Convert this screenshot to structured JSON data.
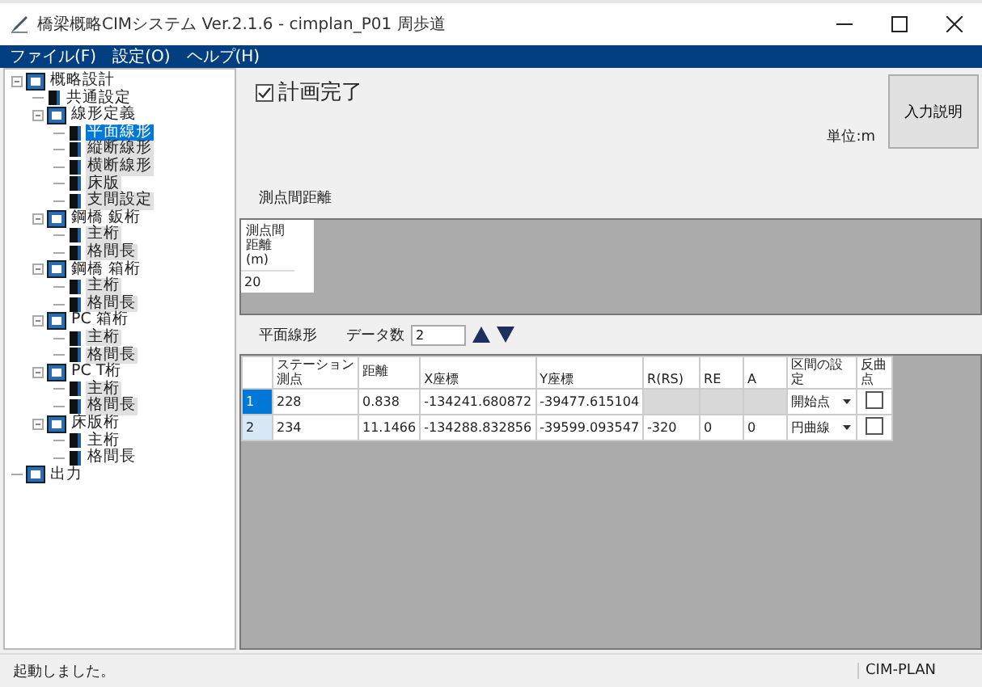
{
  "window": {
    "title": "橋梁概略CIMシステム Ver.2.1.6 - cimplan_P01 周歩道"
  },
  "menu": [
    "ファイル(F)",
    "設定(O)",
    "ヘルプ(H)"
  ],
  "tree": [
    {
      "label": "概略設計",
      "kind": "folder",
      "shaded": false,
      "selected": false,
      "children": [
        {
          "label": "共通設定",
          "kind": "leaf",
          "shaded": false,
          "selected": false
        },
        {
          "label": "線形定義",
          "kind": "folder",
          "shaded": false,
          "selected": false,
          "children": [
            {
              "label": "平面線形",
              "kind": "leaf",
              "shaded": false,
              "selected": true
            },
            {
              "label": "縦断線形",
              "kind": "leaf",
              "shaded": true,
              "selected": false
            },
            {
              "label": "横断線形",
              "kind": "leaf",
              "shaded": true,
              "selected": false
            },
            {
              "label": "床版",
              "kind": "leaf",
              "shaded": true,
              "selected": false
            },
            {
              "label": "支間設定",
              "kind": "leaf",
              "shaded": true,
              "selected": false
            }
          ]
        },
        {
          "label": "鋼橋 鈑桁",
          "kind": "folder",
          "shaded": false,
          "selected": false,
          "children": [
            {
              "label": "主桁",
              "kind": "leaf",
              "shaded": true,
              "selected": false
            },
            {
              "label": "格間長",
              "kind": "leaf",
              "shaded": true,
              "selected": false
            }
          ]
        },
        {
          "label": "鋼橋 箱桁",
          "kind": "folder",
          "shaded": false,
          "selected": false,
          "children": [
            {
              "label": "主桁",
              "kind": "leaf",
              "shaded": true,
              "selected": false
            },
            {
              "label": "格間長",
              "kind": "leaf",
              "shaded": true,
              "selected": false
            }
          ]
        },
        {
          "label": "PC 箱桁",
          "kind": "folder",
          "shaded": false,
          "selected": false,
          "children": [
            {
              "label": "主桁",
              "kind": "leaf",
              "shaded": true,
              "selected": false
            },
            {
              "label": "格間長",
              "kind": "leaf",
              "shaded": true,
              "selected": false
            }
          ]
        },
        {
          "label": "PC T桁",
          "kind": "folder",
          "shaded": false,
          "selected": false,
          "children": [
            {
              "label": "主桁",
              "kind": "leaf",
              "shaded": true,
              "selected": false
            },
            {
              "label": "格間長",
              "kind": "leaf",
              "shaded": true,
              "selected": false
            }
          ]
        },
        {
          "label": "床版桁",
          "kind": "folder",
          "shaded": false,
          "selected": false,
          "children": [
            {
              "label": "主桁",
              "kind": "leaf",
              "shaded": false,
              "selected": false
            },
            {
              "label": "格間長",
              "kind": "leaf",
              "shaded": false,
              "selected": false
            }
          ]
        }
      ]
    },
    {
      "label": "出力",
      "kind": "folder",
      "shaded": false,
      "selected": false
    }
  ],
  "plan_complete": {
    "label": "計画完了",
    "checked": true
  },
  "unit": "単位:m",
  "help_button": "入力説明",
  "interval": {
    "title": "測点間距離",
    "column": "測点間距離(m)",
    "value": "20"
  },
  "alignment": {
    "title": "平面線形",
    "count_label": "データ数",
    "count": "2",
    "columns": [
      "ステーション測点",
      "距離",
      "X座標",
      "Y座標",
      "R(RS)",
      "RE",
      "A",
      "区間の設定",
      "反曲点"
    ],
    "rows": [
      {
        "num": "1",
        "selected": true,
        "cells": [
          "228",
          "0.838",
          "-134241.680872",
          "-39477.615104",
          null,
          null,
          null
        ],
        "section": "開始点",
        "reverse_curve": false
      },
      {
        "num": "2",
        "selected": false,
        "cells": [
          "234",
          "11.1466",
          "-134288.832856",
          "-39599.093547",
          "-320",
          "0",
          "0"
        ],
        "section": "円曲線",
        "reverse_curve": false
      }
    ]
  },
  "status_bar": {
    "message": "起動しました。",
    "app": "CIM-PLAN"
  }
}
